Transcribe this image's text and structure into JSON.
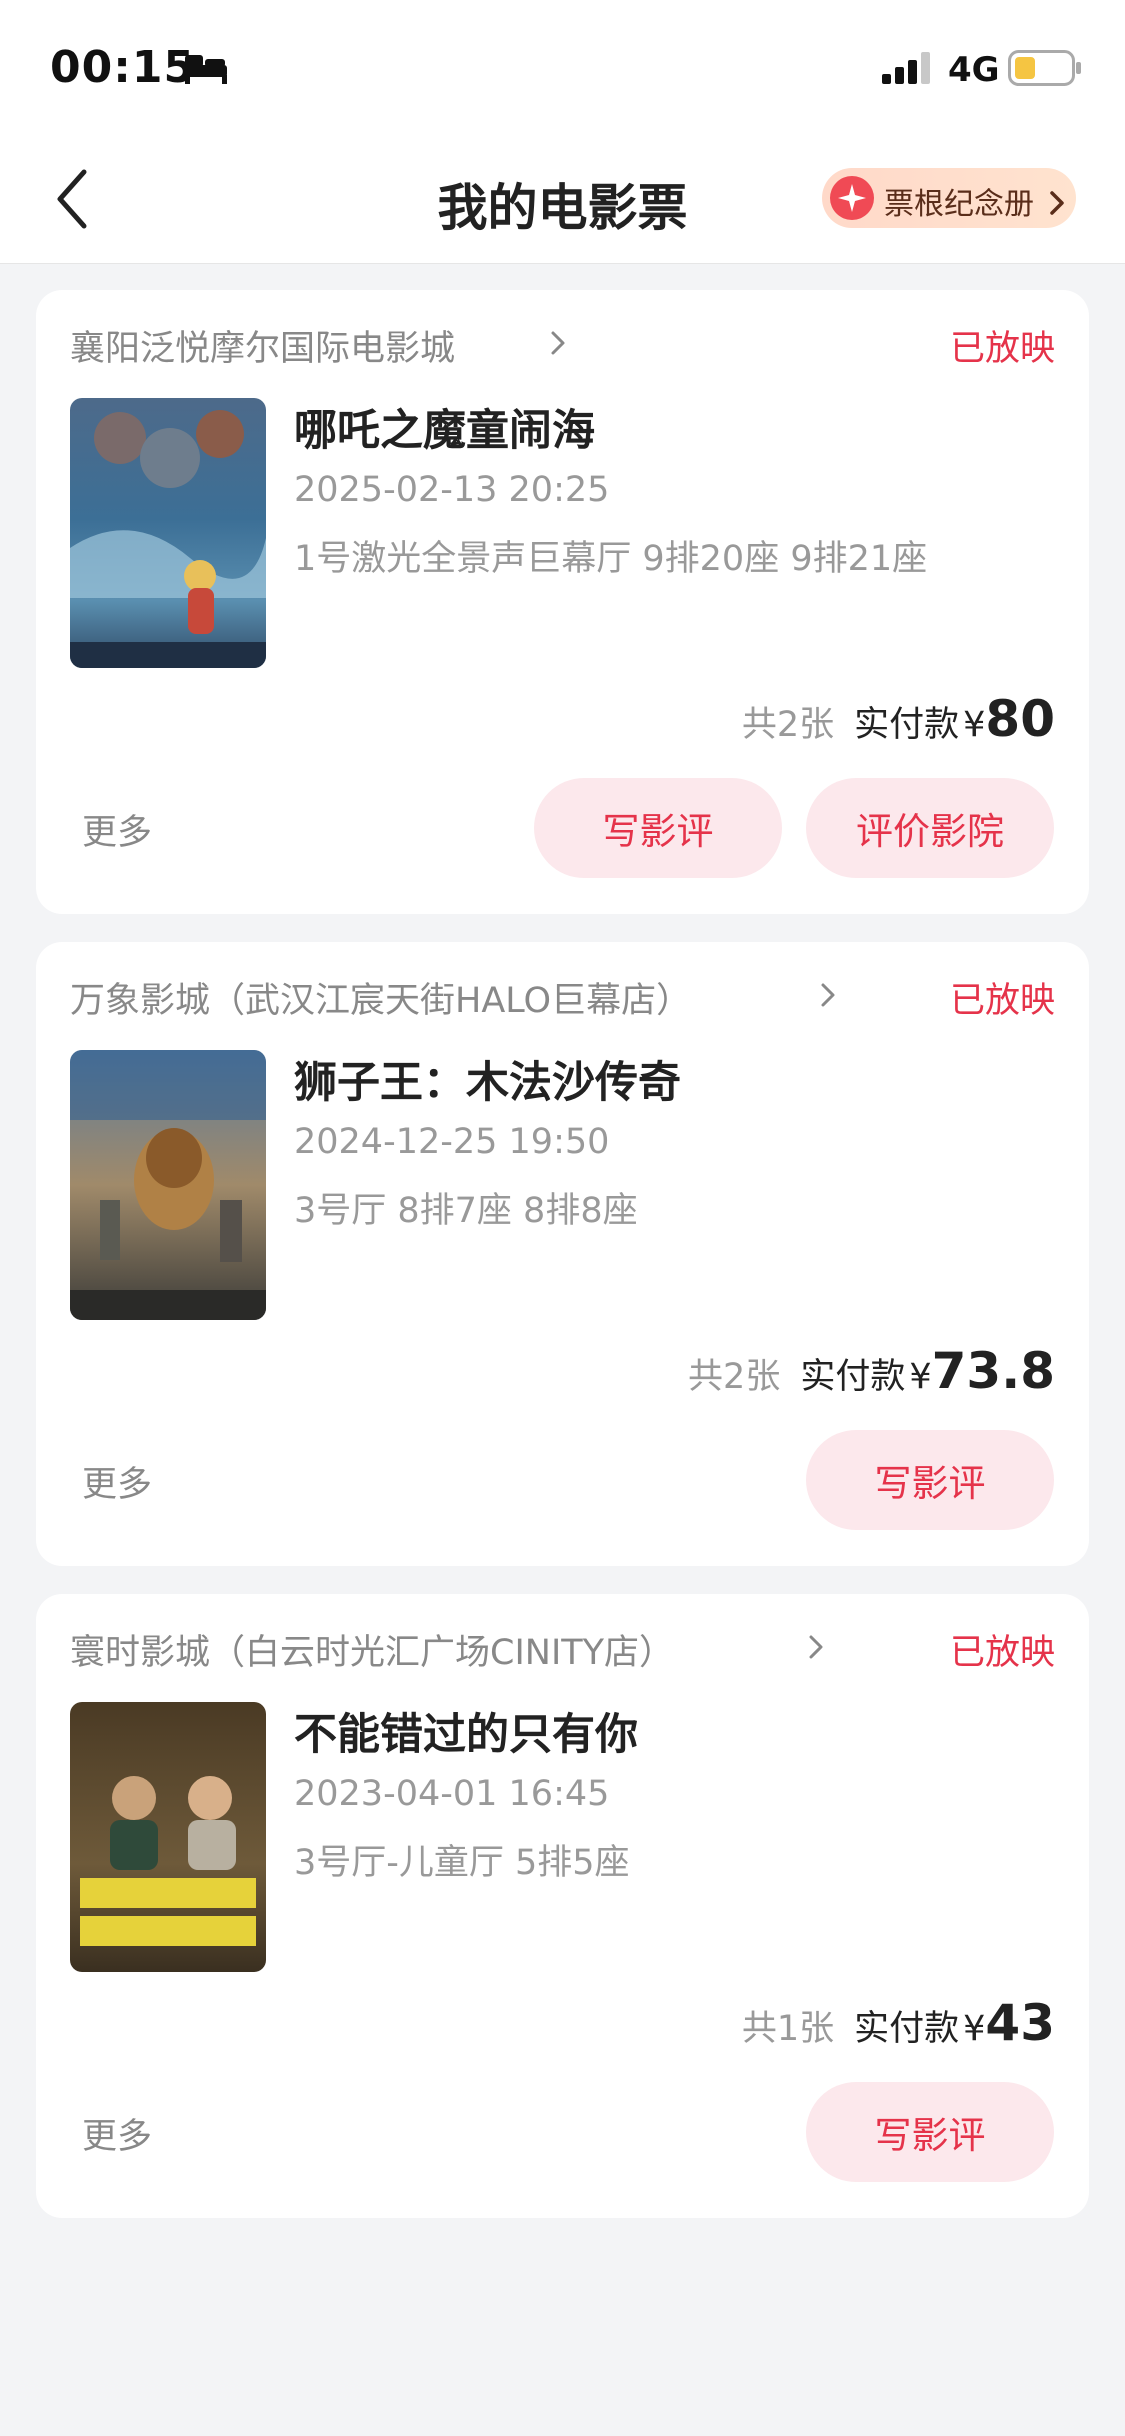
{
  "status_bar": {
    "time": "00:15",
    "network": "4G",
    "icons": [
      "bed-icon",
      "signal-icon",
      "battery-icon"
    ],
    "battery_color": "#f5c542"
  },
  "nav": {
    "title": "我的电影票",
    "back_icon": "chevron-left-icon",
    "stub_album_label": "票根纪念册",
    "stub_album_icon": "sparkle-icon"
  },
  "colors": {
    "accent": "#e5334a",
    "pill_bg": "#fce8ec",
    "page_bg": "#f3f4f6"
  },
  "tickets": [
    {
      "cinema": "襄阳泛悦摩尔国际电影城",
      "status": "已放映",
      "title": "哪吒之魔童闹海",
      "datetime": "2025-02-13 20:25",
      "seats": "1号激光全景声巨幕厅 9排20座 9排21座",
      "count": "共2张",
      "paid_label": "实付款",
      "currency": "¥",
      "price": "80",
      "more": "更多",
      "buttons": [
        "写影评",
        "评价影院"
      ]
    },
    {
      "cinema": "万象影城（武汉江宸天街HALO巨幕店）",
      "status": "已放映",
      "title": "狮子王：木法沙传奇",
      "datetime": "2024-12-25 19:50",
      "seats": "3号厅 8排7座 8排8座",
      "count": "共2张",
      "paid_label": "实付款",
      "currency": "¥",
      "price": "73.8",
      "more": "更多",
      "buttons": [
        "写影评"
      ]
    },
    {
      "cinema": "寰时影城（白云时光汇广场CINITY店）",
      "status": "已放映",
      "title": "不能错过的只有你",
      "datetime": "2023-04-01 16:45",
      "seats": "3号厅-儿童厅 5排5座",
      "count": "共1张",
      "paid_label": "实付款",
      "currency": "¥",
      "price": "43",
      "more": "更多",
      "buttons": [
        "写影评"
      ]
    }
  ]
}
